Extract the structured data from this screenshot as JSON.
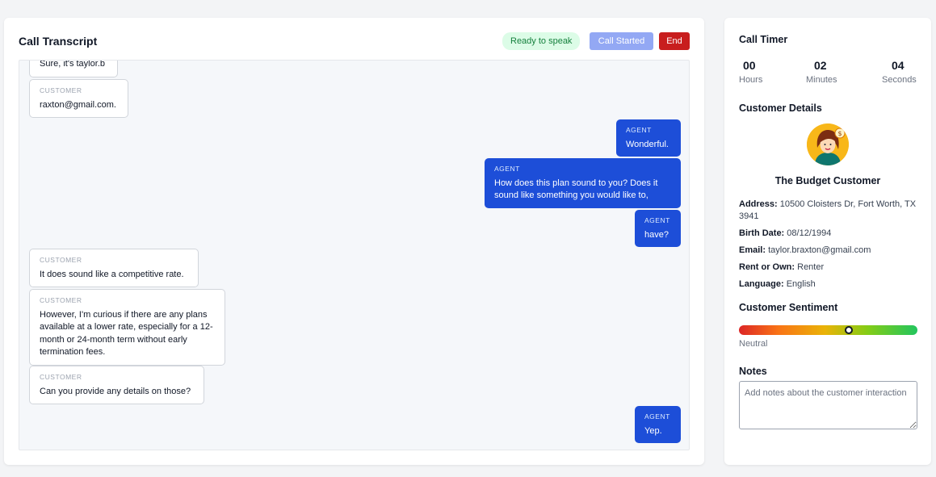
{
  "transcript": {
    "title": "Call Transcript",
    "status": "Ready to speak",
    "call_started_label": "Call Started",
    "end_label": "End",
    "messages": [
      {
        "speaker": "",
        "text": "Sure, it's taylor.b"
      },
      {
        "speaker": "CUSTOMER",
        "text": "raxton@gmail.com."
      },
      {
        "speaker": "AGENT",
        "text": "Wonderful."
      },
      {
        "speaker": "AGENT",
        "text": "How does this plan sound to you? Does it sound like something you would like to,"
      },
      {
        "speaker": "AGENT",
        "text": "have?"
      },
      {
        "speaker": "CUSTOMER",
        "text": "It does sound like a competitive rate."
      },
      {
        "speaker": "CUSTOMER",
        "text": "However, I'm curious if there are any plans available at a lower rate, especially for a 12-month or 24-month term without early termination fees."
      },
      {
        "speaker": "CUSTOMER",
        "text": "Can you provide any details on those?"
      },
      {
        "speaker": "AGENT",
        "text": "Yep."
      }
    ]
  },
  "timer": {
    "title": "Call Timer",
    "hours": "00",
    "hours_label": "Hours",
    "minutes": "02",
    "minutes_label": "Minutes",
    "seconds": "04",
    "seconds_label": "Seconds"
  },
  "customer": {
    "title": "Customer Details",
    "name": "The Budget Customer",
    "address_label": "Address:",
    "address": "10500 Cloisters Dr, Fort Worth, TX 3941",
    "birth_label": "Birth Date:",
    "birth": "08/12/1994",
    "email_label": "Email:",
    "email": "taylor.braxton@gmail.com",
    "rent_label": "Rent or Own:",
    "rent": "Renter",
    "language_label": "Language:",
    "language": "English"
  },
  "sentiment": {
    "title": "Customer Sentiment",
    "label": "Neutral",
    "level": 0.62
  },
  "notes": {
    "title": "Notes",
    "placeholder": "Add notes about the customer interaction"
  },
  "colors": {
    "agent_bubble": "#1d4ed8",
    "end_button": "#c81e1e",
    "status_pill_bg": "#dcfce7",
    "status_pill_text": "#15803d"
  }
}
